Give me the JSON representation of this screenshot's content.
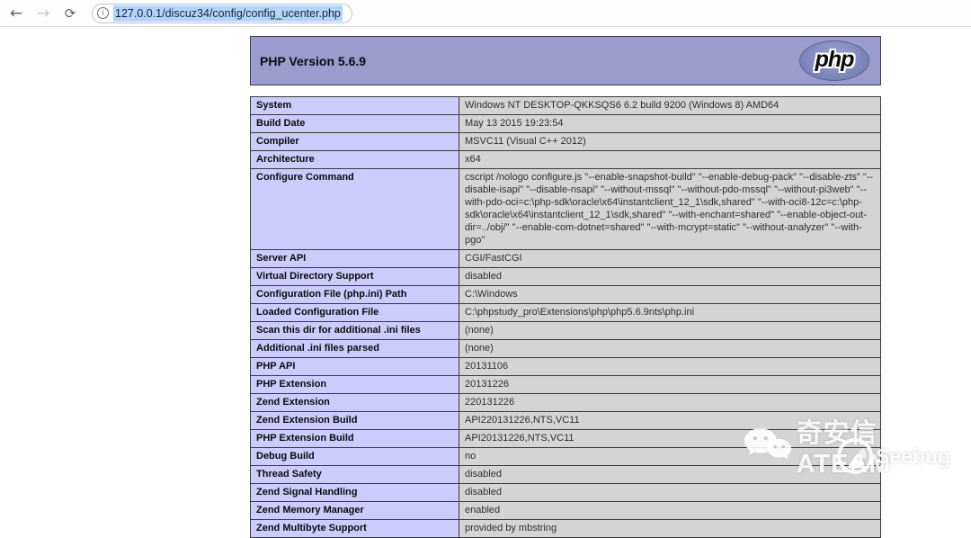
{
  "browser": {
    "back_label": "←",
    "forward_label": "→",
    "refresh_label": "⟳",
    "info_label": "i",
    "url": "127.0.0.1/discuz34/config/config_ucenter.php"
  },
  "phpinfo": {
    "title": "PHP Version 5.6.9",
    "logo_text": "php",
    "rows": [
      {
        "label": "System",
        "value": "Windows NT DESKTOP-QKKSQS6 6.2 build 9200 (Windows 8) AMD64"
      },
      {
        "label": "Build Date",
        "value": "May 13 2015 19:23:54"
      },
      {
        "label": "Compiler",
        "value": "MSVC11 (Visual C++ 2012)"
      },
      {
        "label": "Architecture",
        "value": "x64"
      },
      {
        "label": "Configure Command",
        "value": "cscript /nologo configure.js \"--enable-snapshot-build\" \"--enable-debug-pack\" \"--disable-zts\" \"--disable-isapi\" \"--disable-nsapi\" \"--without-mssql\" \"--without-pdo-mssql\" \"--without-pi3web\" \"--with-pdo-oci=c:\\php-sdk\\oracle\\x64\\instantclient_12_1\\sdk,shared\" \"--with-oci8-12c=c:\\php-sdk\\oracle\\x64\\instantclient_12_1\\sdk,shared\" \"--with-enchant=shared\" \"--enable-object-out-dir=../obj/\" \"--enable-com-dotnet=shared\" \"--with-mcrypt=static\" \"--without-analyzer\" \"--with-pgo\""
      },
      {
        "label": "Server API",
        "value": "CGI/FastCGI"
      },
      {
        "label": "Virtual Directory Support",
        "value": "disabled"
      },
      {
        "label": "Configuration File (php.ini) Path",
        "value": "C:\\Windows"
      },
      {
        "label": "Loaded Configuration File",
        "value": "C:\\phpstudy_pro\\Extensions\\php\\php5.6.9nts\\php.ini"
      },
      {
        "label": "Scan this dir for additional .ini files",
        "value": "(none)"
      },
      {
        "label": "Additional .ini files parsed",
        "value": "(none)"
      },
      {
        "label": "PHP API",
        "value": "20131106"
      },
      {
        "label": "PHP Extension",
        "value": "20131226"
      },
      {
        "label": "Zend Extension",
        "value": "220131226"
      },
      {
        "label": "Zend Extension Build",
        "value": "API220131226,NTS,VC11"
      },
      {
        "label": "PHP Extension Build",
        "value": "API20131226,NTS,VC11"
      },
      {
        "label": "Debug Build",
        "value": "no"
      },
      {
        "label": "Thread Safety",
        "value": "disabled"
      },
      {
        "label": "Zend Signal Handling",
        "value": "disabled"
      },
      {
        "label": "Zend Memory Manager",
        "value": "enabled"
      },
      {
        "label": "Zend Multibyte Support",
        "value": "provided by mbstring"
      }
    ],
    "colors": {
      "header_bg": "#9b9bce",
      "label_bg": "#ccccff",
      "value_bg": "#d4d4d4",
      "border": "#3a3a3a"
    }
  },
  "watermark": {
    "brand": "奇安信ATEAM",
    "sub_brand": "Seebug"
  }
}
